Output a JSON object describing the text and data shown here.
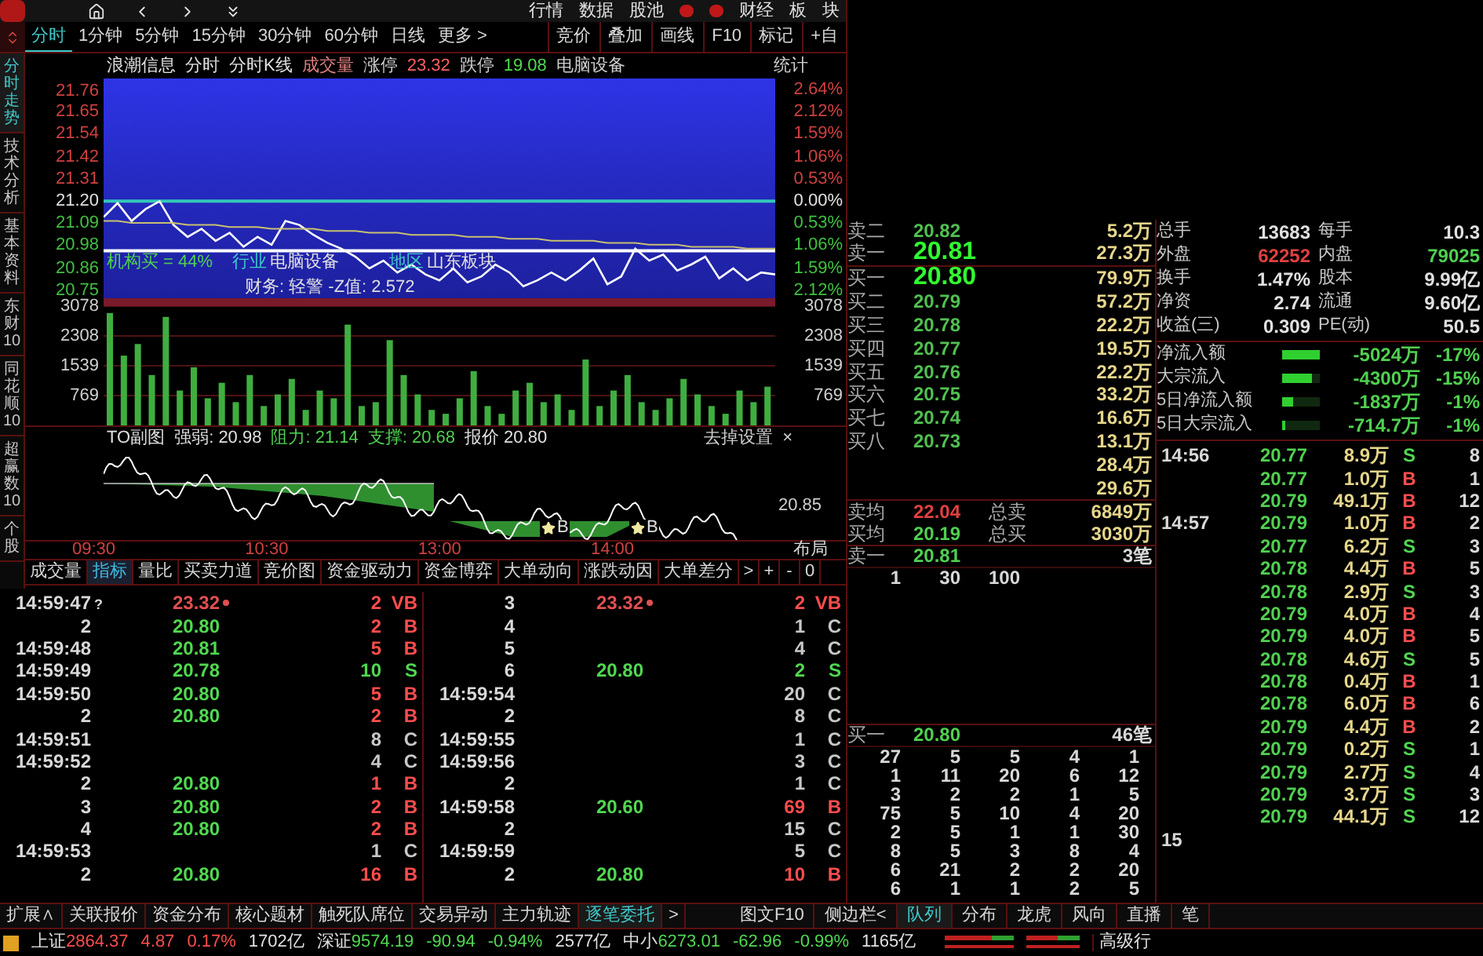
{
  "top_nav": {
    "items": [
      "行情",
      "数据",
      "股池",
      "财经",
      "板",
      "块"
    ]
  },
  "period_tabs": [
    {
      "label": "分时",
      "selected": true
    },
    {
      "label": "1分钟",
      "selected": false
    },
    {
      "label": "5分钟",
      "selected": false
    },
    {
      "label": "15分钟",
      "selected": false
    },
    {
      "label": "30分钟",
      "selected": false
    },
    {
      "label": "60分钟",
      "selected": false
    },
    {
      "label": "日线",
      "selected": false
    },
    {
      "label": "更多 >",
      "selected": false
    }
  ],
  "tool_buttons": [
    "竞价",
    "叠加",
    "画线",
    "F10",
    "标记",
    "+自"
  ],
  "sidebar_tabs": [
    {
      "label": "分时走势",
      "selected": true
    },
    {
      "label": "技术分析",
      "selected": false
    },
    {
      "label": "基本资料",
      "selected": false
    },
    {
      "label": "东财10",
      "selected": false
    },
    {
      "label": "同花顺10",
      "selected": false
    },
    {
      "label": "超赢数10",
      "selected": false
    },
    {
      "label": "个股",
      "selected": false
    }
  ],
  "chart_header": {
    "stock": "浪潮信息",
    "views": [
      "分时",
      "分时K线"
    ],
    "volume_label": "成交量",
    "limit_up_label": "涨停",
    "limit_up": "23.32",
    "limit_down_label": "跌停",
    "limit_down": "19.08",
    "industry": "电脑设备",
    "stats": "统计"
  },
  "price_chart": {
    "chart_data": {
      "type": "line",
      "categories": [
        null,
        null,
        null,
        null,
        null,
        null,
        null,
        null,
        null,
        null,
        null,
        null,
        null,
        null,
        null,
        null,
        null,
        null,
        null,
        null,
        null,
        null,
        null,
        null,
        null,
        null,
        null,
        null,
        null,
        null,
        null,
        null,
        null,
        null,
        null,
        null,
        null,
        null,
        null,
        null,
        null,
        null,
        null,
        null,
        null,
        null,
        null,
        null,
        null
      ],
      "series": [
        {
          "color": "#ffffff",
          "values": [
            21.12,
            21.19,
            21.1,
            21.16,
            21.2,
            21.08,
            21.02,
            21.06,
            21.0,
            21.04,
            20.97,
            21.02,
            20.98,
            21.1,
            21.08,
            21.03,
            20.99,
            20.96,
            20.92,
            20.86,
            20.9,
            20.84,
            20.88,
            20.83,
            20.8,
            20.86,
            20.79,
            20.82,
            20.88,
            20.84,
            20.77,
            20.8,
            20.84,
            20.8,
            20.85,
            20.91,
            20.78,
            20.82,
            20.96,
            20.9,
            20.93,
            20.85,
            20.88,
            20.92,
            20.81,
            20.86,
            20.8,
            20.84,
            20.83
          ]
        },
        {
          "color": "#c8c070",
          "values": [
            21.1,
            21.1,
            21.09,
            21.09,
            21.09,
            21.09,
            21.08,
            21.08,
            21.08,
            21.07,
            21.07,
            21.07,
            21.06,
            21.06,
            21.06,
            21.06,
            21.05,
            21.05,
            21.05,
            21.04,
            21.04,
            21.04,
            21.03,
            21.03,
            21.03,
            21.03,
            21.02,
            21.02,
            21.02,
            21.01,
            21.01,
            21.01,
            21.0,
            21.0,
            21.0,
            21.0,
            20.99,
            20.99,
            20.99,
            20.98,
            20.98,
            20.98,
            20.97,
            20.97,
            20.97,
            20.97,
            20.96,
            20.96,
            20.96
          ]
        }
      ],
      "ylim": [
        20.67,
        21.82
      ],
      "ref_lines": [
        {
          "axis": "y",
          "value": 21.2,
          "color": "#33c8b8"
        },
        {
          "axis": "y",
          "value": 20.95,
          "color": "#ffffff"
        }
      ],
      "yticks": [
        {
          "value": 21.76,
          "label": "21.76"
        },
        {
          "value": 21.65,
          "label": "21.65"
        },
        {
          "value": 21.54,
          "label": "21.54"
        },
        {
          "value": 21.42,
          "label": "21.42"
        },
        {
          "value": 21.31,
          "label": "21.31"
        },
        {
          "value": 21.2,
          "label": "21.20"
        },
        {
          "value": 21.09,
          "label": "21.09"
        },
        {
          "value": 20.98,
          "label": "20.98"
        },
        {
          "value": 20.86,
          "label": "20.86"
        },
        {
          "value": 20.75,
          "label": "20.75"
        }
      ]
    },
    "right_labels": [
      "2.64%",
      "2.12%",
      "1.59%",
      "1.06%",
      "0.53%",
      "0.00%",
      "0.53%",
      "1.06%",
      "1.59%",
      "2.12%"
    ],
    "institution": "机构买 = 44%",
    "industry_label": "行业",
    "industry": "电脑设备",
    "region_label": "地区",
    "region": "山东板块",
    "finance": "财务: 轻警  -Z值: 2.572"
  },
  "volume_chart": {
    "chart_data": {
      "type": "bar",
      "categories": [
        null,
        null,
        null,
        null,
        null,
        null,
        null,
        null,
        null,
        null,
        null,
        null,
        null,
        null,
        null,
        null,
        null,
        null,
        null,
        null,
        null,
        null,
        null,
        null,
        null,
        null,
        null,
        null,
        null,
        null,
        null,
        null,
        null,
        null,
        null,
        null,
        null,
        null,
        null,
        null,
        null,
        null,
        null,
        null,
        null,
        null,
        null,
        null
      ],
      "series": [
        {
          "color": "#3fae3f",
          "values": [
            2900,
            1800,
            2100,
            1300,
            2800,
            900,
            1500,
            700,
            1100,
            600,
            1300,
            500,
            800,
            1200,
            400,
            900,
            700,
            2600,
            500,
            600,
            2200,
            1300,
            800,
            400,
            300,
            700,
            1400,
            500,
            300,
            900,
            1100,
            600,
            800,
            400,
            1700,
            500,
            900,
            1300,
            600,
            400,
            700,
            1200,
            800,
            500,
            300,
            900,
            600,
            1000
          ]
        }
      ],
      "ylim": [
        0,
        3078
      ],
      "grid": true,
      "yticks": [
        3078,
        2308,
        1539,
        769
      ]
    },
    "right_labels": [
      "3078",
      "2308",
      "1539",
      "769"
    ]
  },
  "to_chart": {
    "title": "TO副图",
    "strength": "强弱: 20.98",
    "resistance": "阻力: 21.14",
    "support": "支撑: 20.68",
    "quote": "报价 20.80",
    "settings": "去掉设置",
    "close": "×",
    "right_label": "20.85",
    "markers": [
      "B",
      "B"
    ]
  },
  "time_axis": {
    "labels": [
      "09:30",
      "10:30",
      "13:00",
      "14:00"
    ],
    "layout_button": "布局"
  },
  "indicator_tabs": [
    {
      "label": "成交量",
      "selected": false
    },
    {
      "label": "指标",
      "selected": true
    },
    {
      "label": "量比",
      "selected": false
    },
    {
      "label": "买卖力道",
      "selected": false
    },
    {
      "label": "竞价图",
      "selected": false
    },
    {
      "label": "资金驱动力",
      "selected": false
    },
    {
      "label": "资金博弈",
      "selected": false
    },
    {
      "label": "大单动向",
      "selected": false
    },
    {
      "label": "涨跌动因",
      "selected": false
    },
    {
      "label": "大单差分",
      "selected": false
    }
  ],
  "indicator_buttons": [
    ">",
    "+",
    "-",
    "0"
  ],
  "trades": {
    "left": [
      {
        "time": "14:59:47",
        "note": "?",
        "price": "23.32",
        "limit": true,
        "volume": "2",
        "side": "VB",
        "kind": "buy"
      },
      {
        "time": "2",
        "price": "20.80",
        "volume": "2",
        "side": "B",
        "kind": "buy"
      },
      {
        "time": "14:59:48",
        "price": "20.81",
        "volume": "5",
        "side": "B",
        "kind": "buy"
      },
      {
        "time": "14:59:49",
        "price": "20.78",
        "volume": "10",
        "side": "S",
        "kind": "sell"
      },
      {
        "time": "14:59:50",
        "price": "20.80",
        "volume": "5",
        "side": "B",
        "kind": "buy"
      },
      {
        "time": "2",
        "price": "20.80",
        "volume": "2",
        "side": "B",
        "kind": "buy"
      },
      {
        "time": "14:59:51",
        "volume": "8",
        "side": "C",
        "kind": "neutral"
      },
      {
        "time": "14:59:52",
        "volume": "4",
        "side": "C",
        "kind": "neutral"
      },
      {
        "time": "2",
        "price": "20.80",
        "volume": "1",
        "side": "B",
        "kind": "buy"
      },
      {
        "time": "3",
        "price": "20.80",
        "volume": "2",
        "side": "B",
        "kind": "buy"
      },
      {
        "time": "4",
        "price": "20.80",
        "volume": "2",
        "side": "B",
        "kind": "buy"
      },
      {
        "time": "14:59:53",
        "volume": "1",
        "side": "C",
        "kind": "neutral"
      },
      {
        "time": "2",
        "price": "20.80",
        "volume": "16",
        "side": "B",
        "kind": "buy"
      }
    ],
    "right": [
      {
        "time": "3",
        "price": "23.32",
        "limit": true,
        "volume": "2",
        "side": "VB",
        "kind": "buy"
      },
      {
        "time": "4",
        "volume": "1",
        "side": "C",
        "kind": "neutral"
      },
      {
        "time": "5",
        "volume": "4",
        "side": "C",
        "kind": "neutral"
      },
      {
        "time": "6",
        "price": "20.80",
        "volume": "2",
        "side": "S",
        "kind": "sell"
      },
      {
        "time": "14:59:54",
        "volume": "20",
        "side": "C",
        "kind": "neutral"
      },
      {
        "time": "2",
        "volume": "8",
        "side": "C",
        "kind": "neutral"
      },
      {
        "time": "14:59:55",
        "volume": "1",
        "side": "C",
        "kind": "neutral"
      },
      {
        "time": "14:59:56",
        "volume": "3",
        "side": "C",
        "kind": "neutral"
      },
      {
        "time": "2",
        "volume": "1",
        "side": "C",
        "kind": "neutral"
      },
      {
        "time": "14:59:58",
        "price": "20.60",
        "volume": "69",
        "side": "B",
        "kind": "buy"
      },
      {
        "time": "2",
        "volume": "15",
        "side": "C",
        "kind": "neutral"
      },
      {
        "time": "14:59:59",
        "volume": "5",
        "side": "C",
        "kind": "neutral"
      },
      {
        "time": "2",
        "price": "20.80",
        "volume": "10",
        "side": "B",
        "kind": "buy"
      }
    ]
  },
  "order_book": {
    "asks": [
      {
        "label": "卖二",
        "price": "20.82",
        "volume": "5.2万",
        "emphasis": false
      },
      {
        "label": "卖一",
        "price": "20.81",
        "volume": "27.3万",
        "emphasis": true
      }
    ],
    "bids": [
      {
        "label": "买一",
        "price": "20.80",
        "volume": "79.9万",
        "emphasis": true
      },
      {
        "label": "买二",
        "price": "20.79",
        "volume": "57.2万",
        "emphasis": false
      },
      {
        "label": "买三",
        "price": "20.78",
        "volume": "22.2万",
        "emphasis": false
      },
      {
        "label": "买四",
        "price": "20.77",
        "volume": "19.5万",
        "emphasis": false
      },
      {
        "label": "买五",
        "price": "20.76",
        "volume": "22.2万",
        "emphasis": false
      },
      {
        "label": "买六",
        "price": "20.75",
        "volume": "33.2万",
        "emphasis": false
      },
      {
        "label": "买七",
        "price": "20.74",
        "volume": "16.6万",
        "emphasis": false
      },
      {
        "label": "买八",
        "price": "20.73",
        "volume": "13.1万",
        "emphasis": false
      },
      {
        "volume": "28.4万"
      },
      {
        "volume": "29.6万"
      }
    ],
    "averages": [
      {
        "label": "卖均",
        "price": "22.04",
        "color": "#e04040",
        "total_label": "总卖",
        "total": "6849万"
      },
      {
        "label": "买均",
        "price": "20.19",
        "color": "#50d050",
        "total_label": "总买",
        "total": "3030万"
      }
    ],
    "queues": [
      {
        "label": "卖一",
        "price": "20.81",
        "count": "3笔",
        "rows": [
          [
            "1",
            "30",
            "100"
          ]
        ]
      },
      {
        "label": "买一",
        "price": "20.80",
        "count": "46笔",
        "rows": [
          [
            "27",
            "5",
            "5",
            "4",
            "1"
          ],
          [
            "1",
            "11",
            "20",
            "6",
            "12"
          ],
          [
            "3",
            "2",
            "2",
            "1",
            "5"
          ],
          [
            "75",
            "5",
            "10",
            "4",
            "20"
          ],
          [
            "2",
            "5",
            "1",
            "1",
            "30"
          ],
          [
            "8",
            "5",
            "3",
            "8",
            "4"
          ],
          [
            "6",
            "21",
            "2",
            "2",
            "20"
          ],
          [
            "6",
            "1",
            "1",
            "2",
            "5"
          ]
        ]
      }
    ]
  },
  "stats": [
    {
      "cells": [
        {
          "label": "总手",
          "value": "13683",
          "color": "#e0e0e0"
        },
        {
          "label": "每手",
          "value": "10.3",
          "color": "#e0e0e0"
        }
      ]
    },
    {
      "cells": [
        {
          "label": "外盘",
          "value": "62252",
          "color": "#e04040"
        },
        {
          "label": "内盘",
          "value": "79025",
          "color": "#50d050"
        }
      ]
    },
    {
      "cells": [
        {
          "label": "换手",
          "value": "1.47%",
          "color": "#e0e0e0"
        },
        {
          "label": "股本",
          "value": "9.99亿",
          "color": "#e0e0e0"
        }
      ]
    },
    {
      "cells": [
        {
          "label": "净资",
          "value": "2.74",
          "color": "#e0e0e0"
        },
        {
          "label": "流通",
          "value": "9.60亿",
          "color": "#e0e0e0"
        }
      ]
    },
    {
      "cells": [
        {
          "label": "收益(三)",
          "value": "0.309",
          "color": "#e0e0e0"
        },
        {
          "label": "PE(动)",
          "value": "50.5",
          "color": "#e0e0e0"
        }
      ]
    }
  ],
  "flows": [
    {
      "label": "净流入额",
      "level": 1,
      "amount": "-5024万",
      "pct": "-17%"
    },
    {
      "label": "大宗流入",
      "level": 0.8,
      "amount": "-4300万",
      "pct": "-15%"
    },
    {
      "label": "5日净流入额",
      "level": 0.3,
      "amount": "-1837万",
      "pct": "-1%"
    },
    {
      "label": "5日大宗流入",
      "level": 0.1,
      "amount": "-714.7万",
      "pct": "-1%"
    }
  ],
  "ticks": [
    {
      "time": "14:56",
      "price": "20.77",
      "volume": "8.9万",
      "side": "S",
      "kind": "sell",
      "count": "8"
    },
    {
      "price": "20.77",
      "volume": "1.0万",
      "side": "B",
      "kind": "buy",
      "count": "1"
    },
    {
      "price": "20.79",
      "volume": "49.1万",
      "side": "B",
      "kind": "buy",
      "count": "12"
    },
    {
      "time": "14:57",
      "price": "20.79",
      "volume": "1.0万",
      "side": "B",
      "kind": "buy",
      "count": "2"
    },
    {
      "price": "20.77",
      "volume": "6.2万",
      "side": "S",
      "kind": "sell",
      "count": "3"
    },
    {
      "price": "20.78",
      "volume": "4.4万",
      "side": "B",
      "kind": "buy",
      "count": "5"
    },
    {
      "price": "20.78",
      "volume": "2.9万",
      "side": "S",
      "kind": "sell",
      "count": "3"
    },
    {
      "price": "20.79",
      "volume": "4.0万",
      "side": "B",
      "kind": "buy",
      "count": "4"
    },
    {
      "price": "20.79",
      "volume": "4.0万",
      "side": "B",
      "kind": "buy",
      "count": "5"
    },
    {
      "price": "20.78",
      "volume": "4.6万",
      "side": "S",
      "kind": "sell",
      "count": "5"
    },
    {
      "price": "20.78",
      "volume": "0.4万",
      "side": "B",
      "kind": "buy",
      "count": "1"
    },
    {
      "price": "20.78",
      "volume": "6.0万",
      "side": "B",
      "kind": "buy",
      "count": "6"
    },
    {
      "price": "20.79",
      "volume": "4.4万",
      "side": "B",
      "kind": "buy",
      "count": "2"
    },
    {
      "price": "20.79",
      "volume": "0.2万",
      "side": "S",
      "kind": "sell",
      "count": "1"
    },
    {
      "price": "20.79",
      "volume": "2.7万",
      "side": "S",
      "kind": "sell",
      "count": "4"
    },
    {
      "price": "20.79",
      "volume": "3.7万",
      "side": "S",
      "kind": "sell",
      "count": "3"
    },
    {
      "price": "20.79",
      "volume": "44.1万",
      "side": "S",
      "kind": "sell",
      "count": "12"
    },
    {
      "time": "15"
    }
  ],
  "bottom_tabs": [
    {
      "label": "扩展∧",
      "selected": false
    },
    {
      "label": "关联报价",
      "selected": false
    },
    {
      "label": "资金分布",
      "selected": false
    },
    {
      "label": "核心题材",
      "selected": false
    },
    {
      "label": "触死队席位",
      "selected": false
    },
    {
      "label": "交易异动",
      "selected": false
    },
    {
      "label": "主力轨迹",
      "selected": false
    },
    {
      "label": "逐笔委托",
      "selected": true
    },
    {
      "label": ">",
      "selected": false
    }
  ],
  "side_tabs": [
    {
      "label": "图文F10",
      "selected": false
    },
    {
      "label": "侧边栏<",
      "selected": false
    },
    {
      "label": "队列",
      "selected": true
    },
    {
      "label": "分布",
      "selected": false
    },
    {
      "label": "龙虎",
      "selected": false
    },
    {
      "label": "风向",
      "selected": false
    },
    {
      "label": "直播",
      "selected": false
    },
    {
      "label": "笔",
      "selected": false
    }
  ],
  "status_bar": {
    "indices": [
      {
        "name": "上证",
        "value": "2864.37",
        "change": "4.87",
        "pct": "0.17%",
        "amount": "1702亿",
        "kind": "up"
      },
      {
        "name": "深证",
        "value": "9574.19",
        "change": "-90.94",
        "pct": "-0.94%",
        "amount": "2577亿",
        "kind": "down"
      },
      {
        "name": "中小",
        "value": "6273.01",
        "change": "-62.96",
        "pct": "-0.99%",
        "amount": "1165亿",
        "kind": "down"
      }
    ],
    "advanced": "高级行"
  }
}
